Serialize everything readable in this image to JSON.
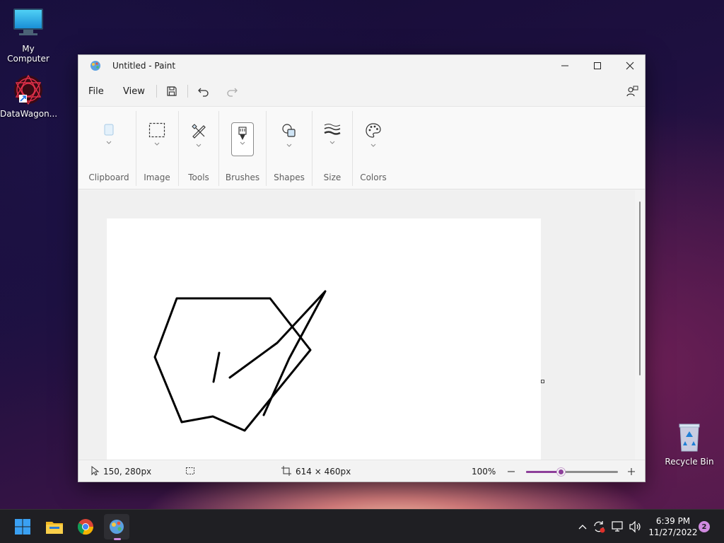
{
  "desktop": {
    "icons": [
      {
        "label": "My Computer"
      },
      {
        "label": "DataWagon..."
      },
      {
        "label": "Recycle Bin"
      }
    ]
  },
  "window": {
    "title": "Untitled - Paint",
    "menu": {
      "file": "File",
      "view": "View"
    },
    "ribbon": {
      "groups": [
        "Clipboard",
        "Image",
        "Tools",
        "Brushes",
        "Shapes",
        "Size",
        "Colors"
      ]
    },
    "status": {
      "cursor_pos": "150, 280px",
      "canvas_size": "614 × 460px",
      "zoom": "100%",
      "zoom_fraction": 0.38
    }
  },
  "taskbar": {
    "time": "6:39 PM",
    "date": "11/27/2022",
    "notifications": "2"
  },
  "colors": {
    "accent": "#8d3f9a",
    "ink": "#000000"
  }
}
